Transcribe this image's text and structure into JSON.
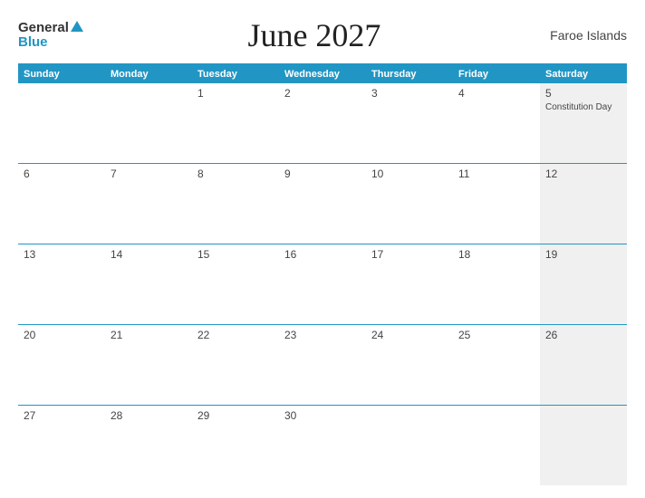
{
  "header": {
    "logo_general": "General",
    "logo_blue": "Blue",
    "title": "June 2027",
    "region": "Faroe Islands"
  },
  "calendar": {
    "days_of_week": [
      "Sunday",
      "Monday",
      "Tuesday",
      "Wednesday",
      "Thursday",
      "Friday",
      "Saturday"
    ],
    "weeks": [
      [
        {
          "day": "",
          "shaded": false
        },
        {
          "day": "",
          "shaded": false
        },
        {
          "day": "1",
          "shaded": false
        },
        {
          "day": "2",
          "shaded": false
        },
        {
          "day": "3",
          "shaded": false
        },
        {
          "day": "4",
          "shaded": false
        },
        {
          "day": "5",
          "event": "Constitution Day",
          "shaded": true
        }
      ],
      [
        {
          "day": "6",
          "shaded": false
        },
        {
          "day": "7",
          "shaded": false
        },
        {
          "day": "8",
          "shaded": false
        },
        {
          "day": "9",
          "shaded": false
        },
        {
          "day": "10",
          "shaded": false
        },
        {
          "day": "11",
          "shaded": false
        },
        {
          "day": "12",
          "shaded": true
        }
      ],
      [
        {
          "day": "13",
          "shaded": false
        },
        {
          "day": "14",
          "shaded": false
        },
        {
          "day": "15",
          "shaded": false
        },
        {
          "day": "16",
          "shaded": false
        },
        {
          "day": "17",
          "shaded": false
        },
        {
          "day": "18",
          "shaded": false
        },
        {
          "day": "19",
          "shaded": true
        }
      ],
      [
        {
          "day": "20",
          "shaded": false
        },
        {
          "day": "21",
          "shaded": false
        },
        {
          "day": "22",
          "shaded": false
        },
        {
          "day": "23",
          "shaded": false
        },
        {
          "day": "24",
          "shaded": false
        },
        {
          "day": "25",
          "shaded": false
        },
        {
          "day": "26",
          "shaded": true
        }
      ],
      [
        {
          "day": "27",
          "shaded": false
        },
        {
          "day": "28",
          "shaded": false
        },
        {
          "day": "29",
          "shaded": false
        },
        {
          "day": "30",
          "shaded": false
        },
        {
          "day": "",
          "shaded": false
        },
        {
          "day": "",
          "shaded": false
        },
        {
          "day": "",
          "shaded": true
        }
      ]
    ]
  }
}
